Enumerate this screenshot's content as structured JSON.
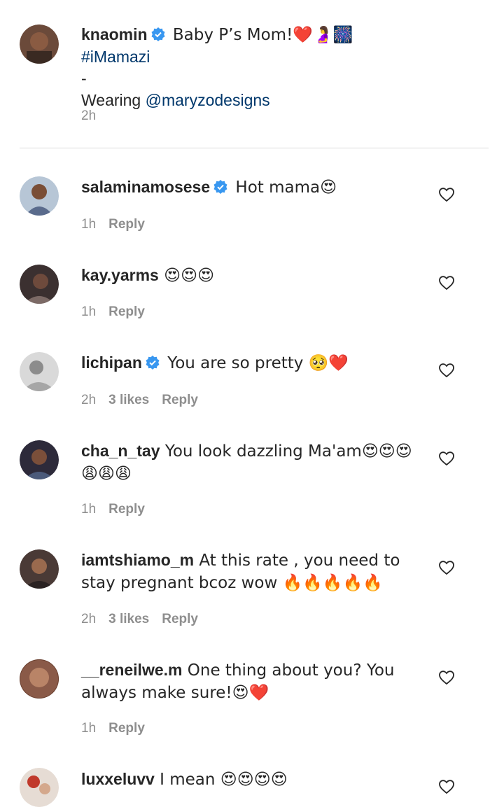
{
  "caption": {
    "username": "knaomin",
    "text_line1": " Baby P’s Mom!❤️🤰🎆 ",
    "hashtag": "#iMamazi",
    "text_line2": "-",
    "text_line3_prefix": "Wearing ",
    "mention": "@maryzodesigns",
    "time": "2h"
  },
  "comments": [
    {
      "username": "salaminamosese",
      "verified": true,
      "text": " Hot mama😍",
      "time": "1h",
      "likes": "",
      "reply": "Reply"
    },
    {
      "username": "kay.yarms",
      "verified": false,
      "text": " 😍😍😍",
      "time": "1h",
      "likes": "",
      "reply": "Reply"
    },
    {
      "username": "lichipan",
      "verified": true,
      "text": " You are so pretty 🥺❤️",
      "time": "2h",
      "likes": "3 likes",
      "reply": "Reply"
    },
    {
      "username": "cha_n_tay",
      "verified": false,
      "text": " You look dazzling Ma'am😍😍😍 😩😩😩",
      "time": "1h",
      "likes": "",
      "reply": "Reply"
    },
    {
      "username": "iamtshiamo_m",
      "verified": false,
      "text": " At this rate , you need to stay pregnant bcoz wow 🔥🔥🔥🔥🔥",
      "time": "2h",
      "likes": "3 likes",
      "reply": "Reply"
    },
    {
      "username": "__reneilwe.m",
      "verified": false,
      "text": " One thing about you? You always make sure!😍❤️",
      "time": "1h",
      "likes": "",
      "reply": "Reply"
    },
    {
      "username": "luxxeluvv",
      "verified": false,
      "text": " I mean 😍😍😍😍",
      "time": "",
      "likes": "",
      "reply": ""
    }
  ],
  "colors": {
    "verified": "#3897f0",
    "link": "#00376b",
    "meta": "#8e8e8e"
  },
  "icons": {
    "verified": "verified-badge-icon",
    "like": "heart-outline-icon"
  }
}
